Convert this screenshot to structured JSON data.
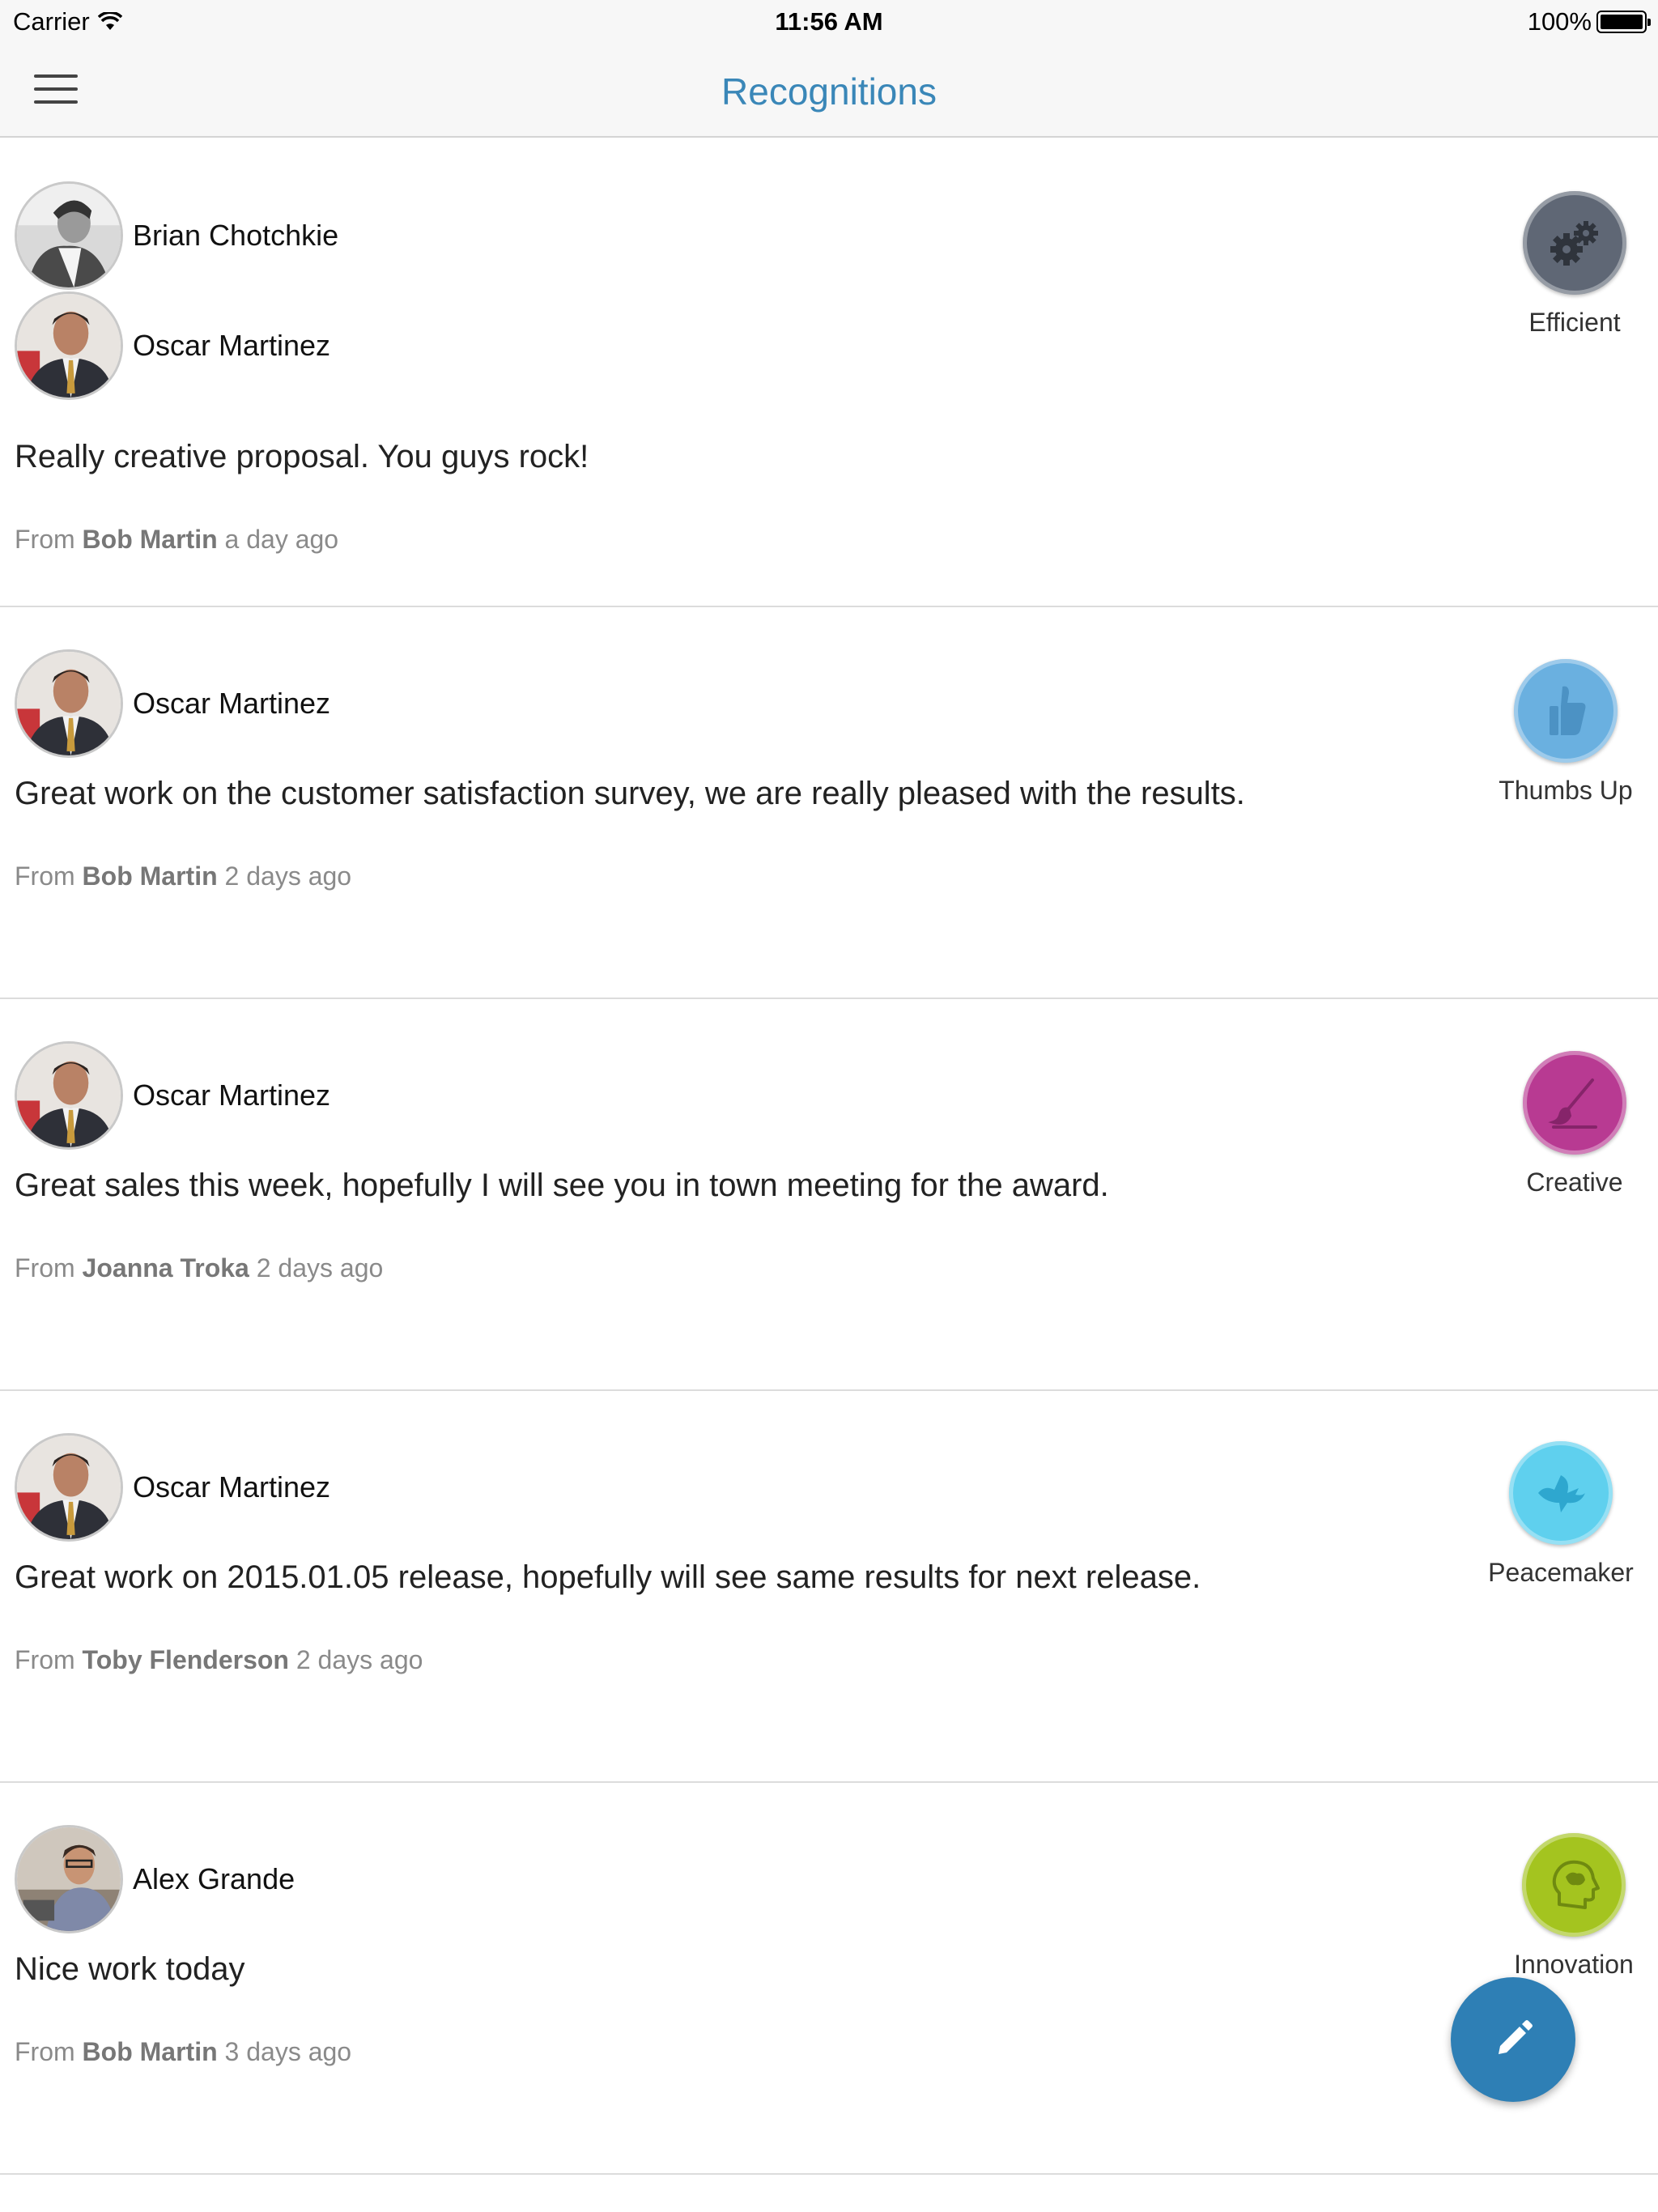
{
  "status_bar": {
    "carrier": "Carrier",
    "time": "11:56 AM",
    "battery": "100%"
  },
  "nav": {
    "title": "Recognitions"
  },
  "colors": {
    "accent": "#3a87b8",
    "fab": "#2e7fb5"
  },
  "recognitions": [
    {
      "recipients": [
        "Brian Chotchkie",
        "Oscar Martinez"
      ],
      "message": "Really creative proposal. You guys rock!",
      "from_prefix": "From",
      "sender": "Bob Martin",
      "time": "a day ago",
      "badge": {
        "label": "Efficient",
        "icon": "gears-icon",
        "color": "#5f6775"
      }
    },
    {
      "recipients": [
        "Oscar Martinez"
      ],
      "message": "Great work on the customer satisfaction survey, we are really pleased with the results.",
      "from_prefix": "From",
      "sender": "Bob Martin",
      "time": "2 days ago",
      "badge": {
        "label": "Thumbs Up",
        "icon": "thumbs-up-icon",
        "color": "#6ab0e0"
      }
    },
    {
      "recipients": [
        "Oscar Martinez"
      ],
      "message": "Great sales this week, hopefully I will see you in town meeting for the award.",
      "from_prefix": "From",
      "sender": "Joanna Troka",
      "time": "2 days ago",
      "badge": {
        "label": "Creative",
        "icon": "paintbrush-icon",
        "color": "#b83a92"
      }
    },
    {
      "recipients": [
        "Oscar Martinez"
      ],
      "message": "Great work on 2015.01.05 release, hopefully will see same results for next release.",
      "from_prefix": "From",
      "sender": "Toby Flenderson",
      "time": "2 days ago",
      "badge": {
        "label": "Peacemaker",
        "icon": "dove-icon",
        "color": "#5fd0ee"
      }
    },
    {
      "recipients": [
        "Alex Grande"
      ],
      "message": "Nice work today",
      "from_prefix": "From",
      "sender": "Bob Martin",
      "time": "3 days ago",
      "badge": {
        "label": "Innovation",
        "icon": "brain-head-icon",
        "color": "#a4c41f"
      }
    }
  ],
  "fab": {
    "icon": "pencil-icon"
  }
}
